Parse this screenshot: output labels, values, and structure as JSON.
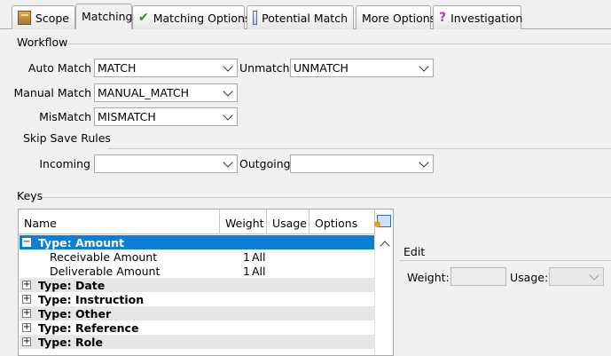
{
  "tabs": [
    {
      "label": "Scope",
      "icon": "box-icon",
      "active": false
    },
    {
      "label": "Matching",
      "icon": "",
      "active": true
    },
    {
      "label": "Matching Options",
      "icon": "checkmark-icon",
      "active": false
    },
    {
      "label": "Potential Match",
      "icon": "match-icon",
      "active": false
    },
    {
      "label": "More Options",
      "icon": "",
      "active": false
    },
    {
      "label": "Investigation",
      "icon": "investigation-icon",
      "active": false
    }
  ],
  "workflow": {
    "title": "Workflow",
    "auto_match": {
      "label": "Auto Match",
      "value": "MATCH"
    },
    "unmatch": {
      "label": "Unmatch",
      "value": "UNMATCH"
    },
    "manual_match": {
      "label": "Manual Match",
      "value": "MANUAL_MATCH"
    },
    "mismatch": {
      "label": "MisMatch",
      "value": "MISMATCH"
    }
  },
  "skip_save": {
    "title": "Skip Save Rules",
    "incoming": {
      "label": "Incoming",
      "value": ""
    },
    "outgoing": {
      "label": "Outgoing",
      "value": ""
    }
  },
  "keys": {
    "title": "Keys",
    "columns": [
      "Name",
      "Weight",
      "Usage",
      "Options"
    ],
    "rows": [
      {
        "kind": "group",
        "label": "Type: Amount",
        "expanded": true,
        "selected": true
      },
      {
        "kind": "child",
        "label": "Receivable Amount",
        "weight": "1",
        "usage": "All"
      },
      {
        "kind": "child",
        "label": "Deliverable Amount",
        "weight": "1",
        "usage": "All"
      },
      {
        "kind": "group",
        "label": "Type: Date",
        "expanded": false
      },
      {
        "kind": "group",
        "label": "Type: Instruction",
        "expanded": false
      },
      {
        "kind": "group",
        "label": "Type: Other",
        "expanded": false
      },
      {
        "kind": "group",
        "label": "Type: Reference",
        "expanded": false
      },
      {
        "kind": "group",
        "label": "Type: Role",
        "expanded": false
      }
    ]
  },
  "edit": {
    "title": "Edit",
    "weight_label": "Weight:",
    "weight_value": "",
    "usage_label": "Usage:",
    "usage_value": ""
  },
  "colors": {
    "selection": "#0a7fd4",
    "background": "#f0f0f0"
  }
}
